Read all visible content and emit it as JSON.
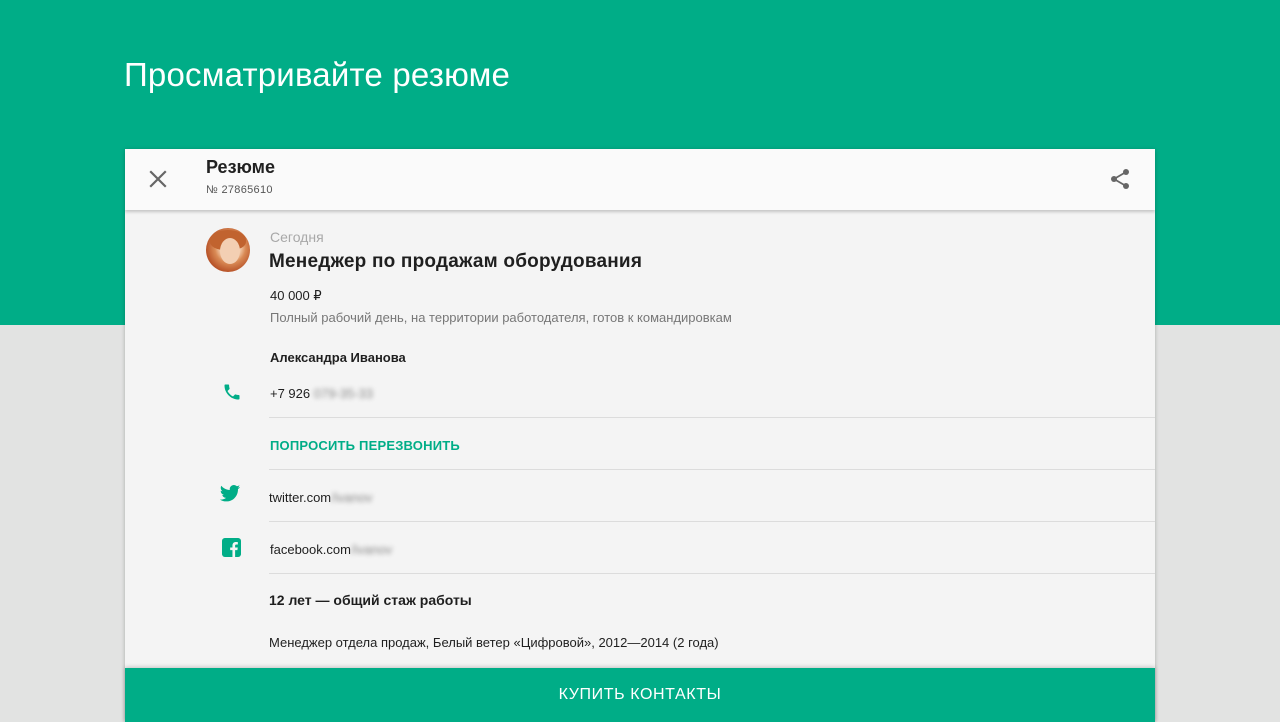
{
  "page": {
    "title": "Просматривайте резюме"
  },
  "toolbar": {
    "close_icon": "close-icon",
    "title": "Резюме",
    "resume_number": "№ 27865610",
    "share_icon": "share-icon"
  },
  "resume": {
    "date": "Сегодня",
    "position": "Менеджер по продажам оборудования",
    "salary": "40 000 ₽",
    "conditions": "Полный рабочий день, на территории работодателя, готов к командировкам",
    "name": "Александра Иванова"
  },
  "contacts": {
    "phone_prefix": "+7 926",
    "phone_hidden": "079-35-33",
    "callback_label": "ПОПРОСИТЬ ПЕРЕЗВОНИТЬ",
    "twitter_prefix": "twitter.com",
    "twitter_hidden": "/ivanov",
    "facebook_prefix": "facebook.com",
    "facebook_hidden": "/ivanov"
  },
  "experience": {
    "total": "12 лет — общий стаж работы",
    "item": "Менеджер отдела продаж, Белый ветер «Цифровой», 2012—2014 (2 года)"
  },
  "footer": {
    "buy_label": "КУПИТЬ КОНТАКТЫ"
  },
  "colors": {
    "accent": "#00ad87",
    "background": "#e2e3e2",
    "card": "#f4f4f4"
  }
}
